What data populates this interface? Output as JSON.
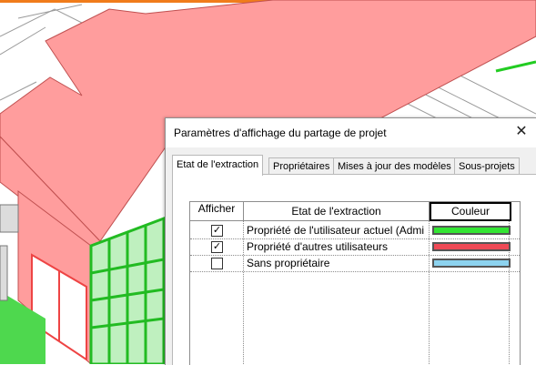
{
  "dialog": {
    "title": "Paramètres d'affichage du partage de projet",
    "close_icon": "close-icon",
    "tabs": [
      {
        "label": "Etat de l'extraction",
        "active": true
      },
      {
        "label": "Propriétaires",
        "active": false
      },
      {
        "label": "Mises à jour des modèles",
        "active": false
      },
      {
        "label": "Sous-projets",
        "active": false
      }
    ],
    "table": {
      "columns": [
        "Afficher",
        "Etat de l'extraction",
        "Couleur"
      ],
      "rows": [
        {
          "checked": true,
          "label": "Propriété de l'utilisateur actuel (Admi",
          "color": "#33e533"
        },
        {
          "checked": true,
          "label": "Propriété d'autres utilisateurs",
          "color": "#ef4a56"
        },
        {
          "checked": false,
          "label": "Sans propriétaire",
          "color": "#8dd3ef"
        }
      ],
      "check_mark": "✓"
    }
  },
  "background": {
    "roof_color": "#ff9d9d",
    "owned_color": "#33dd33",
    "accent_top_color": "#f07c1b"
  }
}
